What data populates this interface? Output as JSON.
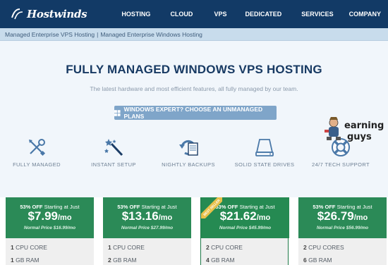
{
  "header": {
    "logo_text": "Hostwinds",
    "nav": [
      "HOSTING",
      "CLOUD",
      "VPS",
      "DEDICATED",
      "SERVICES",
      "COMPANY"
    ]
  },
  "breadcrumb": [
    "Managed Enterprise VPS Hosting",
    "Managed Enterprise Windows Hosting"
  ],
  "hero": {
    "title": "FULLY MANAGED WINDOWS VPS HOSTING",
    "subtitle": "The latest hardware and most efficient features, all fully managed by our team.",
    "cta": "WINDOWS EXPERT? CHOOSE AN UNMANAGED PLANS"
  },
  "features": [
    {
      "label": "FULLY MANAGED",
      "icon": "tools-icon"
    },
    {
      "label": "INSTANT SETUP",
      "icon": "magic-wand-icon"
    },
    {
      "label": "NIGHTLY BACKUPS",
      "icon": "backup-icon"
    },
    {
      "label": "SOLID STATE DRIVES",
      "icon": "drive-icon"
    },
    {
      "label": "24/7 TECH SUPPORT",
      "icon": "lifebuoy-icon"
    }
  ],
  "watermark": {
    "line1": "earning",
    "line2": "guys"
  },
  "plans": [
    {
      "offer_pct": "53% OFF",
      "offer_text": "Starting at Just",
      "price": "$7.99",
      "per": "/mo",
      "normal": "Normal Price $16.99/mo",
      "cpu_n": "1",
      "cpu": "CPU CORE",
      "ram_n": "1",
      "ram": "GB RAM",
      "badge": ""
    },
    {
      "offer_pct": "53% OFF",
      "offer_text": "Starting at Just",
      "price": "$13.16",
      "per": "/mo",
      "normal": "Normal Price $27.99/mo",
      "cpu_n": "1",
      "cpu": "CPU CORE",
      "ram_n": "2",
      "ram": "GB RAM",
      "badge": ""
    },
    {
      "offer_pct": "53% OFF",
      "offer_text": "Starting at Just",
      "price": "$21.62",
      "per": "/mo",
      "normal": "Normal Price $45.99/mo",
      "cpu_n": "2",
      "cpu": "CPU CORE",
      "ram_n": "4",
      "ram": "GB RAM",
      "badge": "BEST SELLER"
    },
    {
      "offer_pct": "53% OFF",
      "offer_text": "Starting at Just",
      "price": "$26.79",
      "per": "/mo",
      "normal": "Normal Price $56.99/mo",
      "cpu_n": "2",
      "cpu": "CPU CORES",
      "ram_n": "6",
      "ram": "GB RAM",
      "badge": ""
    }
  ],
  "colors": {
    "header": "#123a66",
    "accent_green": "#2b8a57",
    "cta": "#7fa5c9",
    "title": "#183a63"
  }
}
